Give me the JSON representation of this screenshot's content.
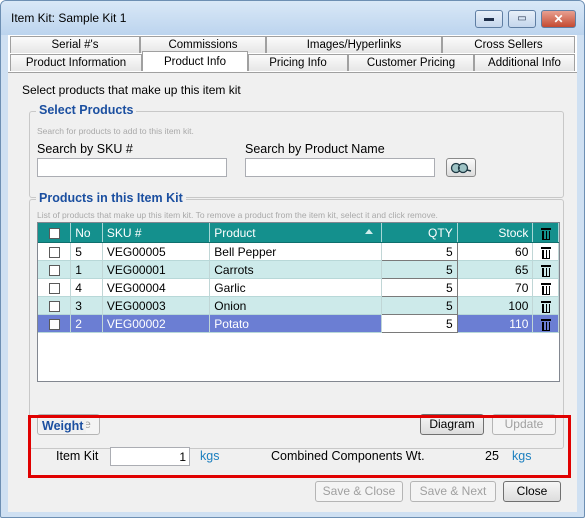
{
  "window": {
    "title": "Item Kit: Sample Kit 1",
    "controls": {
      "minimize": "▬",
      "maximize": "▭",
      "close": "✕"
    }
  },
  "tabs": {
    "row_back": [
      "Serial #'s",
      "Commissions",
      "Images/Hyperlinks",
      "Cross Sellers"
    ],
    "row_front": [
      "Product Information",
      "Product Info",
      "Pricing Info",
      "Customer Pricing",
      "Additional Info"
    ]
  },
  "panel": {
    "hint": "Select products that make up this item kit"
  },
  "select_products": {
    "legend": "Select Products",
    "sub": "Search for products to add to this item kit.",
    "sku_label": "Search by SKU #",
    "sku_value": "",
    "name_label": "Search by Product Name",
    "name_value": "",
    "search_icon": "binoculars-icon"
  },
  "products_in_kit": {
    "legend": "Products in this Item Kit",
    "sub": "List of products that make up this item kit. To remove a product from the item kit, select it and click remove.",
    "columns": {
      "no": "No",
      "sku": "SKU #",
      "product": "Product",
      "qty": "QTY",
      "stock": "Stock"
    },
    "rows": [
      {
        "no": "5",
        "sku": "VEG00005",
        "product": "Bell Pepper",
        "qty": "5",
        "stock": "60",
        "style": "r-white"
      },
      {
        "no": "1",
        "sku": "VEG00001",
        "product": "Carrots",
        "qty": "5",
        "stock": "65",
        "style": "r-teal"
      },
      {
        "no": "4",
        "sku": "VEG00004",
        "product": "Garlic",
        "qty": "5",
        "stock": "70",
        "style": "r-white"
      },
      {
        "no": "3",
        "sku": "VEG00003",
        "product": "Onion",
        "qty": "5",
        "stock": "100",
        "style": "r-teal"
      },
      {
        "no": "2",
        "sku": "VEG00002",
        "product": "Potato",
        "qty": "5",
        "stock": "110",
        "style": "r-sel"
      }
    ],
    "buttons": {
      "remove": "Remove",
      "diagram": "Diagram",
      "update": "Update"
    }
  },
  "weight": {
    "legend": "Weight",
    "item_kit_label": "Item Kit",
    "item_kit_value": "1",
    "unit": "kgs",
    "combined_label": "Combined Components Wt.",
    "combined_value": "25",
    "combined_unit": "kgs"
  },
  "footer": {
    "save_close": "Save & Close",
    "save_next": "Save & Next",
    "close": "Close"
  },
  "colors": {
    "header_teal": "#14908d",
    "legend_blue": "#1b4fa0",
    "highlight_red": "#e00000",
    "unit_blue": "#1b7fbf"
  }
}
